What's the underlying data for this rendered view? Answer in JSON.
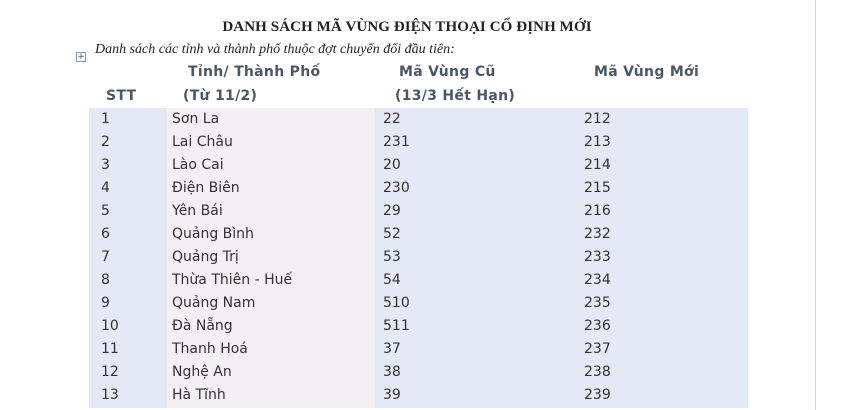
{
  "title": "DANH SÁCH MÃ VÙNG ĐIỆN THOẠI CỐ ĐỊNH MỚI",
  "subtitle": "Danh sách các tỉnh và thành phố thuộc đợt chuyển đổi đầu tiên:",
  "headers": {
    "stt": "STT",
    "province_line1": "Tỉnh/ Thành Phố",
    "province_line2": "(Từ 11/2)",
    "old_line1": "Mã Vùng Cũ",
    "old_line2": "(13/3 Hết Hạn)",
    "new": "Mã Vùng Mới"
  },
  "rows": [
    {
      "stt": "1",
      "name": "Sơn La",
      "old": "22",
      "new": "212"
    },
    {
      "stt": "2",
      "name": "Lai Châu",
      "old": "231",
      "new": "213"
    },
    {
      "stt": "3",
      "name": "Lào Cai",
      "old": "20",
      "new": "214"
    },
    {
      "stt": "4",
      "name": "Điện Biên",
      "old": "230",
      "new": "215"
    },
    {
      "stt": "5",
      "name": "Yên Bái",
      "old": "29",
      "new": "216"
    },
    {
      "stt": "6",
      "name": "Quảng Bình",
      "old": "52",
      "new": "232"
    },
    {
      "stt": "7",
      "name": "Quảng Trị",
      "old": "53",
      "new": "233"
    },
    {
      "stt": "8",
      "name": "Thừa Thiên - Huế",
      "old": "54",
      "new": "234"
    },
    {
      "stt": "9",
      "name": "Quảng Nam",
      "old": "510",
      "new": "235"
    },
    {
      "stt": "10",
      "name": "Đà Nẵng",
      "old": "511",
      "new": "236"
    },
    {
      "stt": "11",
      "name": "Thanh Hoá",
      "old": "37",
      "new": "237"
    },
    {
      "stt": "12",
      "name": "Nghệ An",
      "old": "38",
      "new": "238"
    },
    {
      "stt": "13",
      "name": "Hà Tĩnh",
      "old": "39",
      "new": "239"
    }
  ]
}
